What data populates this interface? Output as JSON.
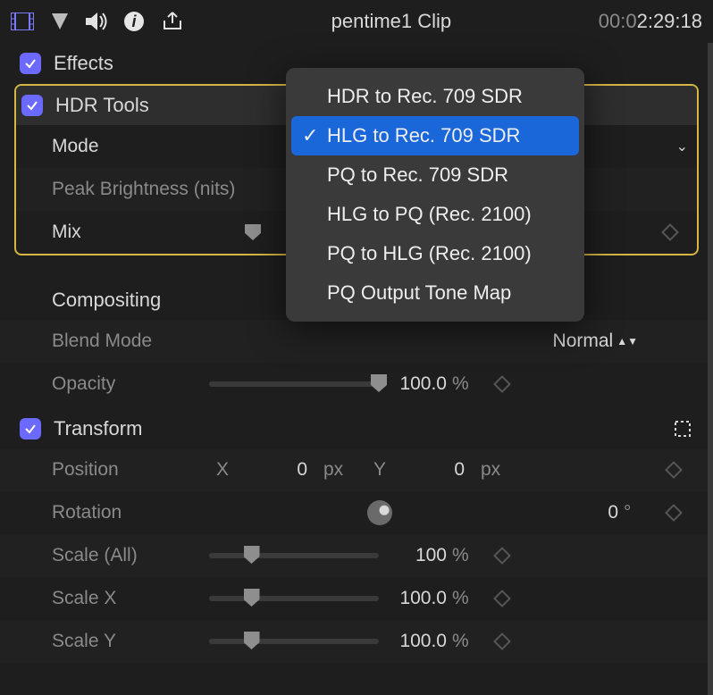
{
  "toolbar": {
    "clip_title": "pentime1 Clip",
    "timecode_dim": "00:0",
    "timecode": "2:29:18"
  },
  "effects": {
    "title": "Effects",
    "checked": true,
    "hdr": {
      "title": "HDR Tools",
      "checked": true,
      "mode_label": "Mode",
      "mode_value": "HLG to Rec. 709 SDR",
      "peak_label": "Peak Brightness (nits)",
      "mix_label": "Mix",
      "menu": [
        "HDR to Rec. 709 SDR",
        "HLG to Rec. 709 SDR",
        "PQ to Rec. 709 SDR",
        "HLG to PQ (Rec. 2100)",
        "PQ to HLG (Rec. 2100)",
        "PQ Output Tone Map"
      ],
      "menu_selected": 1
    }
  },
  "compositing": {
    "title": "Compositing",
    "blend_label": "Blend Mode",
    "blend_value": "Normal",
    "opacity_label": "Opacity",
    "opacity_value": "100.0",
    "opacity_unit": "%"
  },
  "transform": {
    "title": "Transform",
    "checked": true,
    "position_label": "Position",
    "x_label": "X",
    "x_value": "0",
    "x_unit": "px",
    "y_label": "Y",
    "y_value": "0",
    "y_unit": "px",
    "rotation_label": "Rotation",
    "rotation_value": "0",
    "rotation_unit": "°",
    "scale_all_label": "Scale (All)",
    "scale_all_value": "100",
    "scale_all_unit": "%",
    "scale_x_label": "Scale X",
    "scale_x_value": "100.0",
    "scale_x_unit": "%",
    "scale_y_label": "Scale Y",
    "scale_y_value": "100.0",
    "scale_y_unit": "%"
  }
}
